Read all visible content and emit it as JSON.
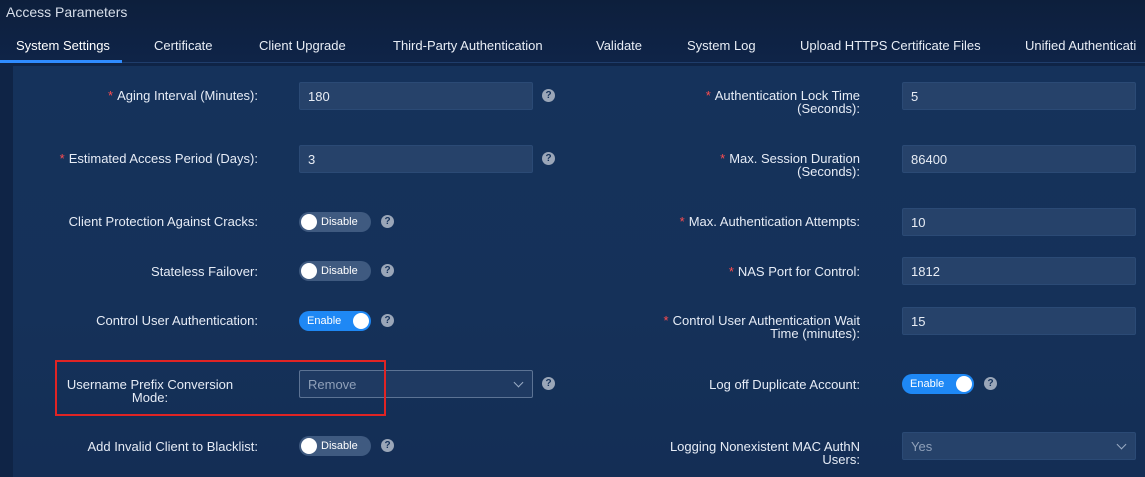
{
  "window": {
    "title": "Access Parameters"
  },
  "tabs": [
    {
      "label": "System Settings"
    },
    {
      "label": "Certificate"
    },
    {
      "label": "Client Upgrade"
    },
    {
      "label": "Third-Party Authentication"
    },
    {
      "label": "Validate"
    },
    {
      "label": "System Log"
    },
    {
      "label": "Upload HTTPS Certificate Files"
    },
    {
      "label": "Unified Authenticati"
    }
  ],
  "colors": {
    "accent": "#2f8cff",
    "required": "#ff4d4f",
    "toggle_on": "#1e88f5",
    "toggle_off": "#3f5a80",
    "highlight": "#e02424"
  },
  "left": {
    "aging": {
      "required": "*",
      "label_a": "Aging Interval (Minutes)",
      "colon": ":",
      "value": "180"
    },
    "estimated": {
      "required": "*",
      "label_a": "Estimated Access Period (Days)",
      "colon": ":",
      "value": "3"
    },
    "crack": {
      "label_a": "Client Protection Against Cracks",
      "colon": ":",
      "toggle": "Disable"
    },
    "stateless": {
      "label_a": "Stateless Failover",
      "colon": ":",
      "toggle": "Disable"
    },
    "control_auth": {
      "label_a": "Control User Authentication",
      "colon": ":",
      "toggle": "Enable"
    },
    "prefix": {
      "label_a": "Username Prefix Conversion",
      "label_b": "Mode",
      "colon": ":",
      "value": "Remove"
    },
    "blacklist": {
      "label_a": "Add Invalid Client to Blacklist",
      "colon": ":",
      "toggle": "Disable"
    }
  },
  "right": {
    "lock_time": {
      "required": "*",
      "label_a": "Authentication Lock Time",
      "label_b": "(Seconds)",
      "colon": ":",
      "value": "5"
    },
    "session": {
      "required": "*",
      "label_a": "Max. Session Duration",
      "label_b": "(Seconds)",
      "colon": ":",
      "value": "86400"
    },
    "attempts": {
      "required": "*",
      "label_a": "Max. Authentication Attempts",
      "colon": ":",
      "value": "10"
    },
    "nas_port": {
      "required": "*",
      "label_a": "NAS Port for Control",
      "colon": ":",
      "value": "1812"
    },
    "wait_time": {
      "required": "*",
      "label_a": "Control User Authentication Wait",
      "label_b": "Time (minutes)",
      "colon": ":",
      "value": "15"
    },
    "logoff": {
      "label_a": "Log off Duplicate Account",
      "colon": ":",
      "toggle": "Enable"
    },
    "mac_log": {
      "label_a": "Logging Nonexistent MAC AuthN",
      "label_b": "Users",
      "colon": ":",
      "value": "Yes"
    }
  },
  "icons": {
    "help": "question-circle-icon",
    "dropdown": "chevron-down-icon"
  },
  "help_glyph": "?"
}
